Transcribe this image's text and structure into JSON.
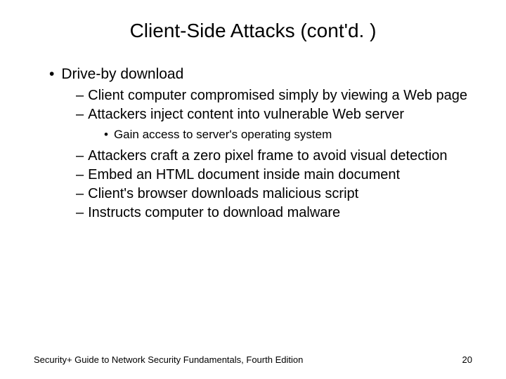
{
  "title": "Client-Side Attacks (cont'd. )",
  "top_bullet": "Drive-by download",
  "dash1": "Client computer compromised simply by viewing a Web page",
  "dash2": "Attackers inject content into vulnerable Web server",
  "sub_bullet": "Gain access to server's operating system",
  "dash3": "Attackers craft a zero pixel frame to avoid visual detection",
  "dash4": "Embed an HTML document inside main document",
  "dash5": "Client's browser downloads malicious script",
  "dash6": "Instructs computer to download malware",
  "footer_left": "Security+ Guide to Network Security Fundamentals, Fourth Edition",
  "footer_right": "20"
}
